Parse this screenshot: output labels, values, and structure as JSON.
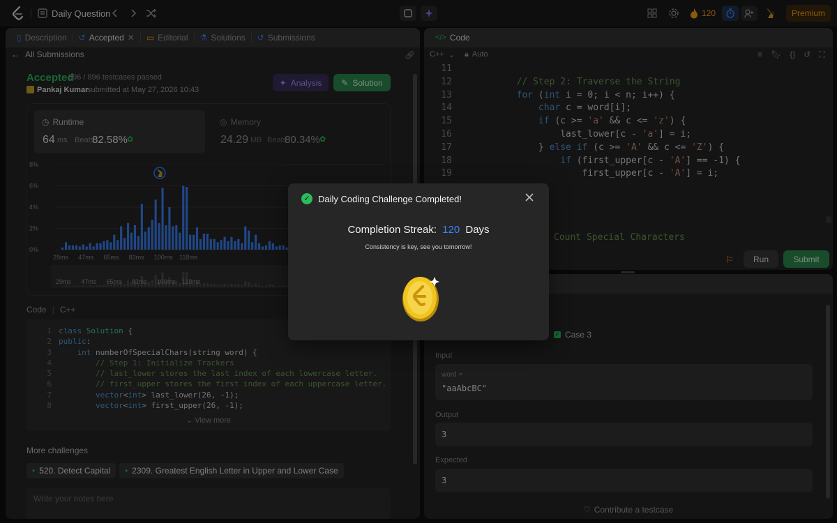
{
  "topbar": {
    "title": "Daily Question",
    "streak_count": "120",
    "premium_label": "Premium"
  },
  "left_tabs": [
    "Description",
    "Accepted",
    "Editorial",
    "Solutions",
    "Submissions"
  ],
  "submission": {
    "back_label": "All Submissions",
    "status": "Accepted",
    "testcases": "896 / 896 testcases passed",
    "user": "Pankaj Kumar",
    "submitted_text": "submitted at May 27, 2026 10:43",
    "analysis_label": "Analysis",
    "solution_label": "Solution",
    "runtime": {
      "label": "Runtime",
      "value": "64",
      "unit": "ms",
      "beats_label": "Beats",
      "beats": "82.58%"
    },
    "memory": {
      "label": "Memory",
      "value": "24.29",
      "unit": "MB",
      "beats_label": "Beats",
      "beats": "80.34%"
    }
  },
  "chart_data": {
    "type": "bar",
    "y_ticks": [
      "8%",
      "6%",
      "4%",
      "2%",
      "0%"
    ],
    "ylim": [
      0,
      8
    ],
    "x_ticks": [
      "29ms",
      "47ms",
      "65ms",
      "83ms",
      "100ms",
      "118ms"
    ],
    "mini_x_ticks": [
      "29ms",
      "47ms",
      "65ms",
      "83ms",
      "100ms",
      "118ms"
    ],
    "values": [
      0.2,
      0.7,
      0.4,
      0.4,
      0.4,
      0.3,
      0.5,
      0.3,
      0.6,
      0.3,
      0.6,
      0.6,
      0.8,
      0.9,
      0.7,
      1.4,
      0.9,
      2.2,
      1.1,
      2.5,
      1.6,
      2.3,
      1.3,
      4.3,
      1.7,
      2.1,
      2.8,
      4.7,
      2.5,
      5.8,
      2.3,
      4.0,
      2.2,
      2.3,
      1.6,
      6.0,
      5.9,
      1.4,
      1.4,
      2.1,
      1.0,
      1.5,
      1.5,
      1.0,
      1.0,
      0.7,
      0.9,
      1.2,
      0.8,
      1.2,
      0.8,
      1.0,
      0.6,
      2.2,
      1.8,
      0.7,
      1.4,
      0.6,
      0.3,
      0.4,
      0.8,
      0.6,
      0.3,
      0.4,
      0.4,
      0.2,
      0.3,
      0.5,
      0.9,
      1.4,
      0.6,
      0.5,
      0.4,
      0.6,
      0.3,
      0.3,
      0.4,
      0.7,
      0.3,
      0.3,
      0.4,
      0.7,
      0.3,
      0.2,
      0.3,
      0.3,
      0.3,
      0.3,
      0.3,
      0.3,
      0.3,
      0.4,
      0.3,
      0.3
    ],
    "highlight_index": 29,
    "color": "#3b82f6"
  },
  "code_section": {
    "label": "Code",
    "lang": "C++",
    "view_more": "View more",
    "lines": [
      {
        "n": "1",
        "text": "class Solution {"
      },
      {
        "n": "2",
        "text": "public:"
      },
      {
        "n": "3",
        "text": "    int numberOfSpecialChars(string word) {"
      },
      {
        "n": "4",
        "text": "        // Step 1: Initialize Trackers"
      },
      {
        "n": "5",
        "text": "        // last_lower stores the last index of each lowercase letter."
      },
      {
        "n": "6",
        "text": "        // first_upper stores the first index of each uppercase letter."
      },
      {
        "n": "7",
        "text": "        vector<int> last_lower(26, -1);"
      },
      {
        "n": "8",
        "text": "        vector<int> first_upper(26, -1);"
      }
    ]
  },
  "more_challenges": {
    "label": "More challenges",
    "items": [
      "520. Detect Capital",
      "2309. Greatest English Letter in Upper and Lower Case"
    ],
    "notes_placeholder": "Write your notes here"
  },
  "editor": {
    "title": "Code",
    "lang": "C++",
    "mode": "Auto",
    "run_label": "Run",
    "submit_label": "Submit",
    "lines": [
      {
        "n": "11",
        "text": ""
      },
      {
        "n": "12",
        "text": "        // Step 2: Traverse the String"
      },
      {
        "n": "13",
        "text": "        for (int i = 0; i < n; i++) {"
      },
      {
        "n": "14",
        "text": "            char c = word[i];"
      },
      {
        "n": "15",
        "text": "            if (c >= 'a' && c <= 'z') {"
      },
      {
        "n": "16",
        "text": "                last_lower[c - 'a'] = i;"
      },
      {
        "n": "17",
        "text": "            } else if (c >= 'A' && c <= 'Z') {"
      },
      {
        "n": "18",
        "text": "                if (first_upper[c - 'A'] == -1) {"
      },
      {
        "n": "19",
        "text": "                    first_upper[c - 'A'] = i;"
      }
    ],
    "hidden_comment": "Count Special Characters"
  },
  "testcase": {
    "case3": "Case 3",
    "input_label": "Input",
    "var_name": "word =",
    "input_value": "\"aaAbcBC\"",
    "output_label": "Output",
    "output_value": "3",
    "expected_label": "Expected",
    "expected_value": "3",
    "contribute": "Contribute a testcase"
  },
  "modal": {
    "title": "Daily Coding Challenge Completed!",
    "streak_prefix": "Completion Streak:",
    "streak_value": "120",
    "streak_suffix": "Days",
    "subtitle": "Consistency is key, see you tomorrow!"
  },
  "colors": {
    "accent_green": "#2cbb5d",
    "accent_blue": "#3b82f6",
    "orange": "#ffa116"
  }
}
